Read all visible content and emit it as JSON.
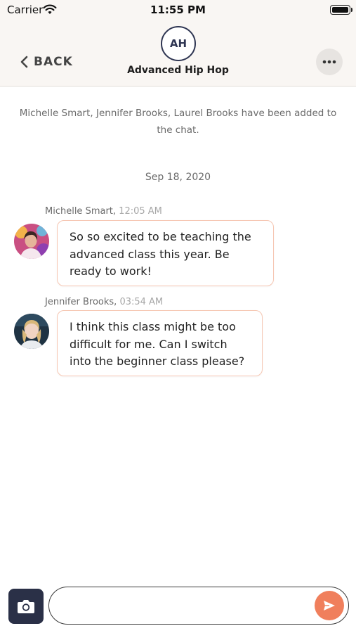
{
  "status_bar": {
    "carrier": "Carrier",
    "time": "11:55 PM"
  },
  "header": {
    "back_label": "BACK",
    "avatar_initials": "AH",
    "title": "Advanced Hip Hop"
  },
  "system_message": "Michelle Smart, Jennifer Brooks, Laurel Brooks have been added to the chat.",
  "date_separator": "Sep 18, 2020",
  "messages": [
    {
      "sender": "Michelle Smart,",
      "time": "12:05 AM",
      "text": "So so excited to be teaching the advanced class this year. Be ready to work!"
    },
    {
      "sender": "Jennifer Brooks,",
      "time": "03:54 AM",
      "text": "I think this class might be too difficult for me. Can I switch into the beginner class please?"
    }
  ],
  "composer": {
    "value": "",
    "placeholder": ""
  },
  "colors": {
    "accent": "#f07f5c",
    "navy": "#2a3047",
    "bubble_border": "#f6c7b3",
    "header_bg": "#f9f6f3"
  },
  "icons": [
    "wifi-icon",
    "battery-icon",
    "chevron-left-icon",
    "more-icon",
    "camera-icon",
    "send-icon"
  ]
}
